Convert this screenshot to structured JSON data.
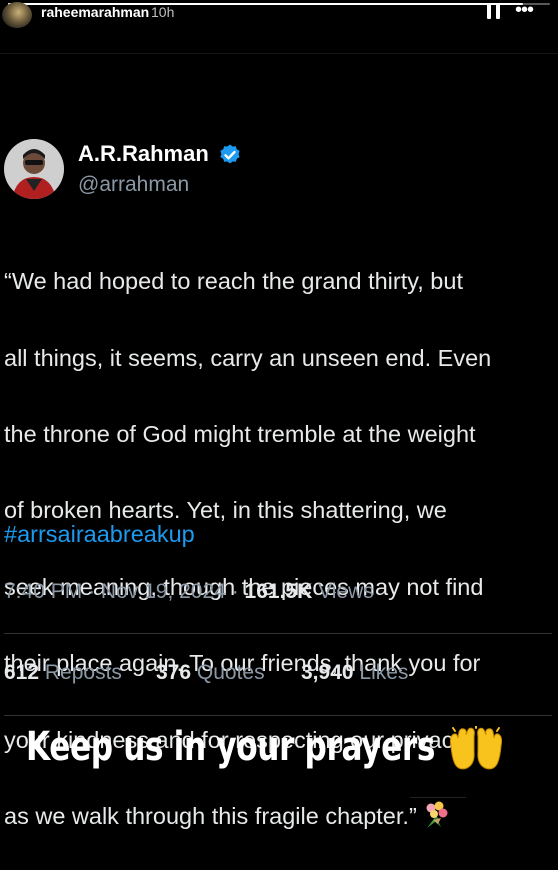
{
  "story": {
    "username": "raheemarahman",
    "time": "10h",
    "progress_fraction": 0.95,
    "controls": {
      "pause_icon": "pause-icon",
      "more_icon": "more-icon",
      "more_label": "•••"
    }
  },
  "tweet": {
    "display_name": "A.R.Rahman",
    "handle": "@arrahman",
    "verified": true,
    "text_lines": [
      "“We had hoped to reach the grand thirty, but",
      "all things, it seems, carry an unseen end. Even",
      "the throne of God might tremble at the weight",
      "of broken hearts. Yet, in this shattering, we",
      "seek meaning, though the pieces may not find",
      "their place again. To our friends, thank you for",
      "your kindness and for respecting our privacy",
      "as we walk through this fragile chapter.”"
    ],
    "emoji_after_text": "bouquet-icon",
    "hashtag": "#arrsairaabreakup",
    "time": "7:40 PM",
    "date": "Nov 19, 2024",
    "separator": "·",
    "views_count": "161.5K",
    "views_label": "Views",
    "reposts_count": "612",
    "reposts_label": "Reposts",
    "quotes_count": "376",
    "quotes_label": "Quotes",
    "likes_count": "3,940",
    "likes_label": "Likes"
  },
  "caption": {
    "text": "Keep us in your prayers",
    "emoji": "raising-hands-icon"
  },
  "colors": {
    "background": "#000000",
    "text": "#e7e9ea",
    "muted": "#8b98a5",
    "link": "#1d9bf0",
    "verified": "#1d9bf0"
  }
}
